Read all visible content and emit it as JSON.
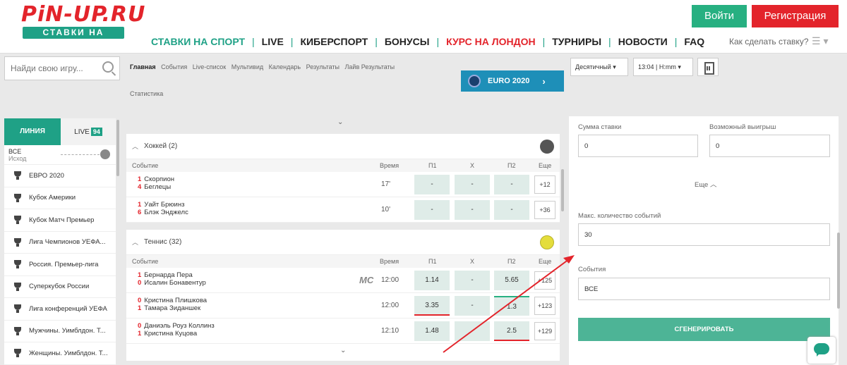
{
  "header": {
    "logo_main": "PiN-UP.RU",
    "logo_sub": "СТАВКИ НА СПОРТ",
    "login": "Войти",
    "register": "Регистрация",
    "nav": [
      {
        "label": "СТАВКИ НА СПОРТ",
        "color": "green"
      },
      {
        "label": "LIVE",
        "color": "dark"
      },
      {
        "label": "КИБЕРСПОРТ",
        "color": "dark"
      },
      {
        "label": "БОНУСЫ",
        "color": "dark"
      },
      {
        "label": "КУРС НА ЛОНДОН",
        "color": "red"
      },
      {
        "label": "ТУРНИРЫ",
        "color": "dark"
      },
      {
        "label": "НОВОСТИ",
        "color": "dark"
      },
      {
        "label": "FAQ",
        "color": "dark"
      }
    ],
    "how_to": "Как сделать ставку?"
  },
  "toolbar": {
    "search_placeholder": "Найди свою игру...",
    "subnav": [
      "Главная",
      "События",
      "Live-список",
      "Мультивид",
      "Календарь",
      "Результаты",
      "Лайв Результаты"
    ],
    "stats": "Статистика",
    "euro_label": "EURO 2020",
    "odds_format": "Десятичный",
    "time_format": "13:04 | H:mm"
  },
  "sidebar": {
    "tab_line": "ЛИНИЯ",
    "tab_live": "LIVE",
    "live_count": "94",
    "filter_value": "ВСЕ",
    "filter_label": "Исход",
    "items": [
      "ЕВРО 2020",
      "Кубок Америки",
      "Кубок Матч Премьер",
      "Лига Чемпионов УЕФА...",
      "Россия. Премьер-лига",
      "Суперкубок России",
      "Лига конференций УЕФА",
      "Мужчины. Уимблдон. Т...",
      "Женщины. Уимблдон. Т..."
    ]
  },
  "columns": {
    "event": "Событие",
    "time": "Время",
    "p1": "П1",
    "x": "X",
    "p2": "П2",
    "more": "Еще"
  },
  "hockey": {
    "title": "Хоккей  (2)",
    "rows": [
      {
        "s1": "1",
        "n1": "Скорпион",
        "s2": "4",
        "n2": "Беглецы",
        "time": "17'",
        "p1": "-",
        "x": "-",
        "p2": "-",
        "more": "+12"
      },
      {
        "s1": "1",
        "n1": "Уайт Брюинз",
        "s2": "6",
        "n2": "Блэк Энджелс",
        "time": "10'",
        "p1": "-",
        "x": "-",
        "p2": "-",
        "more": "+36"
      }
    ]
  },
  "tennis": {
    "title": "Теннис  (32)",
    "rows": [
      {
        "s1": "1",
        "n1": "Бернарда Пера",
        "s2": "0",
        "n2": "Исалин Бонавентур",
        "mc": "MC",
        "time": "12:00",
        "p1": "1.14",
        "x": "-",
        "p2": "5.65",
        "more": "+125"
      },
      {
        "s1": "0",
        "n1": "Кристина Плишкова",
        "s2": "1",
        "n2": "Тамара Зиданшек",
        "time": "12:00",
        "p1": "3.35",
        "x": "-",
        "p2": "1.3",
        "more": "+123"
      },
      {
        "s1": "0",
        "n1": "Даниэль Роуз Коллинз",
        "s2": "1",
        "n2": "Кристина Куцова",
        "time": "12:10",
        "p1": "1.48",
        "x": "",
        "p2": "2.5",
        "more": "+129"
      }
    ]
  },
  "right": {
    "stake_label": "Сумма ставки",
    "win_label": "Возможный выигрыш",
    "stake_value": "0",
    "win_value": "0",
    "more": "Еще",
    "max_events_label": "Макс. количество событий",
    "max_events_value": "30",
    "events_label": "События",
    "events_value": "ВСЕ",
    "generate": "СГЕНЕРИРОВАТЬ"
  },
  "colors": {
    "brand_green": "#1fa186",
    "brand_red": "#e3242b",
    "odd_bg": "#dfece8"
  }
}
